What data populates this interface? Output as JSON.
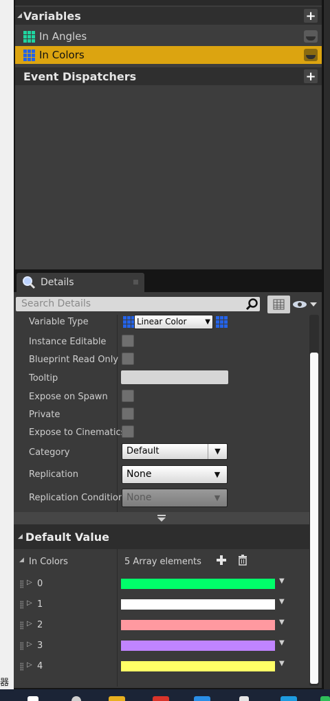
{
  "left_strip_char": "器",
  "my_blueprint": {
    "variables_header": "Variables",
    "variables": [
      {
        "name": "In Angles",
        "icon": "array-grid-icon",
        "color": "#1fd4a0",
        "selected": false
      },
      {
        "name": "In Colors",
        "icon": "array-grid-icon",
        "color": "#2463e8",
        "selected": true
      }
    ],
    "event_dispatchers_header": "Event Dispatchers",
    "add_glyph": "+"
  },
  "details": {
    "tab_title": "Details",
    "search_placeholder": "Search Details",
    "properties": {
      "variable_type_label": "Variable Type",
      "variable_type_value": "Linear Color",
      "instance_editable_label": "Instance Editable",
      "blueprint_read_only_label": "Blueprint Read Only",
      "tooltip_label": "Tooltip",
      "expose_on_spawn_label": "Expose on Spawn",
      "private_label": "Private",
      "expose_to_cinematics_label": "Expose to Cinematics",
      "category_label": "Category",
      "category_value": "Default",
      "replication_label": "Replication",
      "replication_value": "None",
      "replication_condition_label": "Replication Condition",
      "replication_condition_value": "None"
    },
    "default_value_header": "Default Value",
    "array": {
      "name": "In Colors",
      "summary": "5 Array elements",
      "elements": [
        {
          "index": "0",
          "color": "#00ff6a"
        },
        {
          "index": "1",
          "color": "#ffffff"
        },
        {
          "index": "2",
          "color": "#ff99a0"
        },
        {
          "index": "3",
          "color": "#c084ff"
        },
        {
          "index": "4",
          "color": "#ffff66"
        }
      ]
    }
  },
  "colors": {
    "selected_row": "#dca410",
    "angles_type": "#1fd4a0",
    "colors_type": "#2463e8"
  }
}
